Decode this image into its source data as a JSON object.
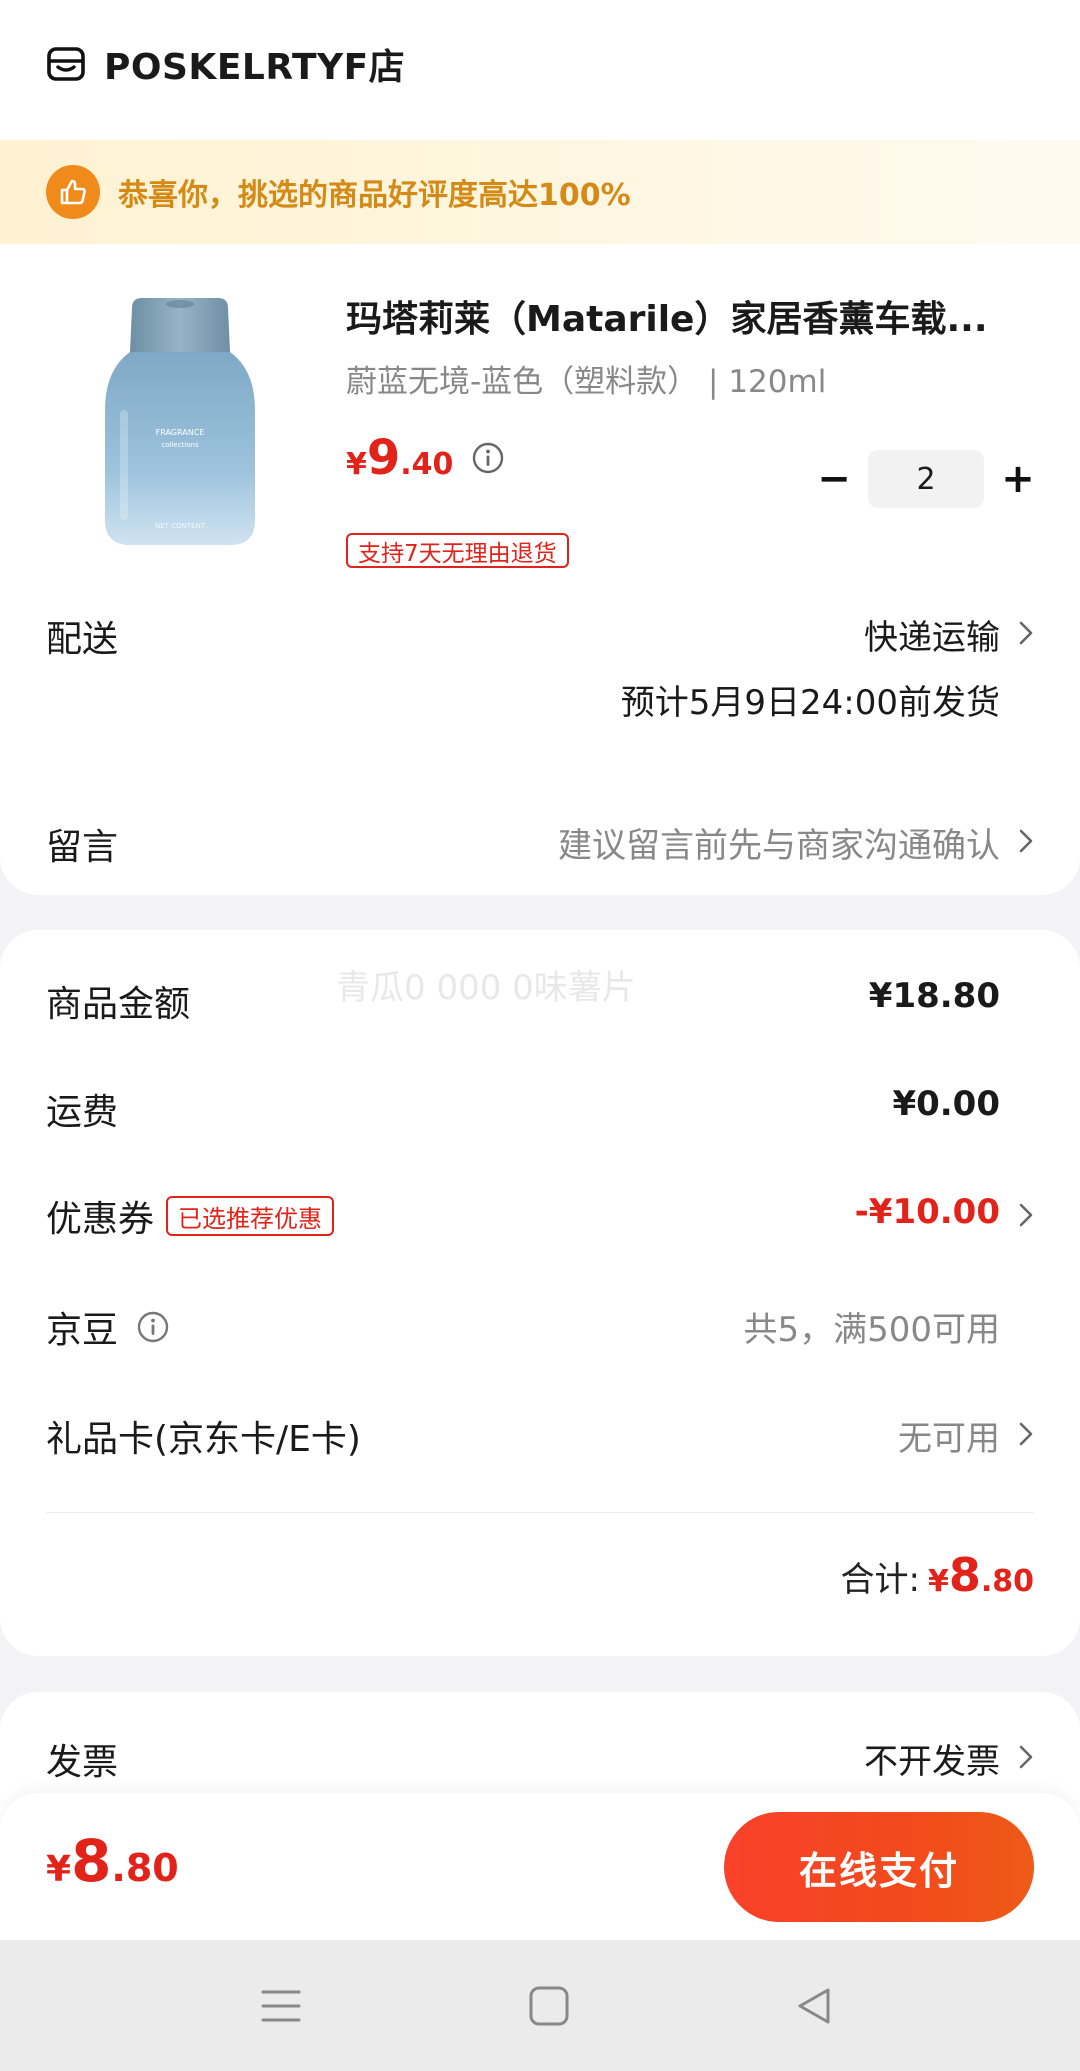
{
  "shop": {
    "name": "POSKELRTYF店",
    "icon": "store-icon"
  },
  "banner": {
    "text": "恭喜你，挑选的商品好评度高达100%",
    "icon": "thumbs-up-icon",
    "color": "#d48a17"
  },
  "product": {
    "title": "玛塔莉莱（Matarile）家居香薰车载...",
    "spec": "蔚蓝无境-蓝色（塑料款） | 120ml",
    "price": {
      "currency": "¥",
      "integer": "9",
      "decimal": ".40"
    },
    "quantity": "2",
    "minus": "−",
    "plus": "+",
    "return_tag": "支持7天无理由退货",
    "image": "perfume-bottle-image"
  },
  "delivery": {
    "label": "配送",
    "method": "快递运输",
    "estimate": "预计5月9日24:00前发货"
  },
  "message": {
    "label": "留言",
    "placeholder": "建议留言前先与商家沟通确认"
  },
  "summary": {
    "watermark": "青瓜0 000 0味薯片",
    "goods_amount": {
      "label": "商品金额",
      "value": "¥18.80"
    },
    "shipping": {
      "label": "运费",
      "value": "¥0.00"
    },
    "coupon": {
      "label": "优惠券",
      "tag": "已选推荐优惠",
      "value": "-¥10.00"
    },
    "jingdou": {
      "label": "京豆",
      "value": "共5，满500可用"
    },
    "gift_card": {
      "label": "礼品卡(京东卡/E卡)",
      "value": "无可用"
    },
    "total": {
      "label": "合计:",
      "currency": "¥",
      "integer": "8",
      "decimal": ".80"
    }
  },
  "invoice": {
    "label": "发票",
    "value": "不开发票"
  },
  "bottom_bar": {
    "price": {
      "currency": "¥",
      "integer": "8",
      "decimal": ".80"
    },
    "pay_button": "在线支付"
  },
  "colors": {
    "accent_red": "#e2231a",
    "pay_gradient": "#f9412a",
    "banner_bg": "#fff2d2"
  }
}
